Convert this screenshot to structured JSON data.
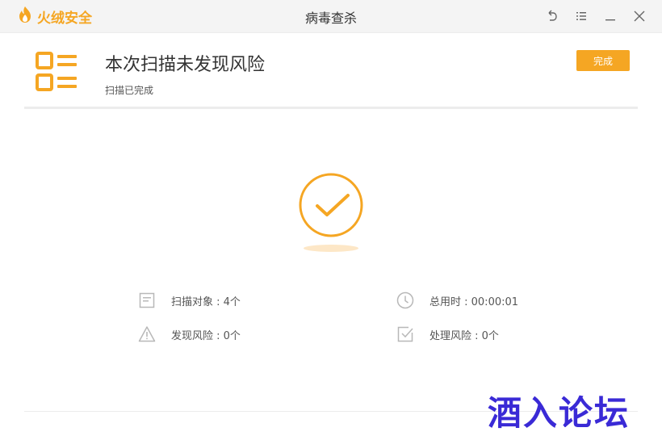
{
  "titlebar": {
    "brand_name": "火绒安全",
    "window_title": "病毒查杀",
    "controls": [
      "back-icon",
      "menu-icon",
      "minimize-icon",
      "close-icon"
    ]
  },
  "header": {
    "title": "本次扫描未发现风险",
    "subtitle": "扫描已完成",
    "done_label": "完成"
  },
  "stats": {
    "scan_objects": "扫描对象 : 4个",
    "total_time": "总用时 : 00:00:01",
    "risks_found": "发现风险 : 0个",
    "risks_handled": "处理风险 : 0个"
  },
  "watermark": "酒入论坛",
  "colors": {
    "accent": "#f5a623",
    "icon_gray": "#b8b8b8",
    "text": "#333333"
  }
}
